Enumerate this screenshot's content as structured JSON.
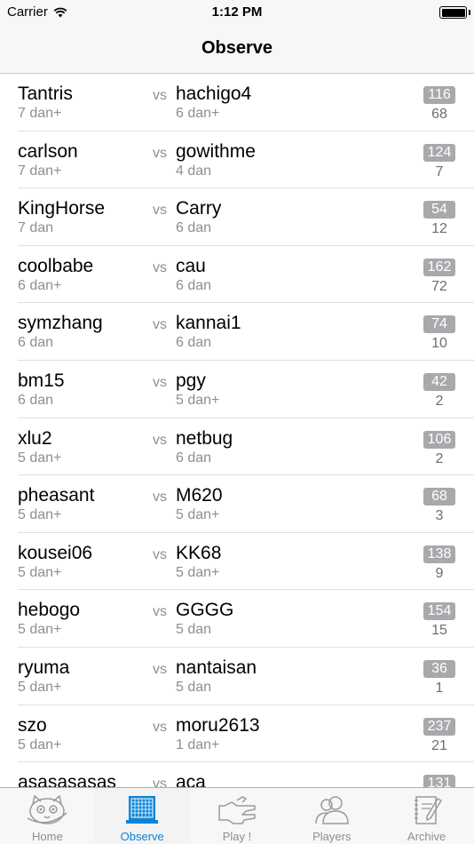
{
  "status_bar": {
    "carrier": "Carrier",
    "time": "1:12 PM"
  },
  "nav": {
    "title": "Observe"
  },
  "vs_label": "vs",
  "games": [
    {
      "p1": "Tantris",
      "p1_rank": "7 dan+",
      "p2": "hachigo4",
      "p2_rank": "6 dan+",
      "moves": "116",
      "observers": "68"
    },
    {
      "p1": "carlson",
      "p1_rank": "7 dan+",
      "p2": "gowithme",
      "p2_rank": "4 dan",
      "moves": "124",
      "observers": "7"
    },
    {
      "p1": "KingHorse",
      "p1_rank": "7 dan",
      "p2": "Carry",
      "p2_rank": "6 dan",
      "moves": "54",
      "observers": "12"
    },
    {
      "p1": "coolbabe",
      "p1_rank": "6 dan+",
      "p2": "cau",
      "p2_rank": "6 dan",
      "moves": "162",
      "observers": "72"
    },
    {
      "p1": "symzhang",
      "p1_rank": "6 dan",
      "p2": "kannai1",
      "p2_rank": "6 dan",
      "moves": "74",
      "observers": "10"
    },
    {
      "p1": "bm15",
      "p1_rank": "6 dan",
      "p2": "pgy",
      "p2_rank": "5 dan+",
      "moves": "42",
      "observers": "2"
    },
    {
      "p1": "xlu2",
      "p1_rank": "5 dan+",
      "p2": "netbug",
      "p2_rank": "6 dan",
      "moves": "106",
      "observers": "2"
    },
    {
      "p1": "pheasant",
      "p1_rank": "5 dan+",
      "p2": "M620",
      "p2_rank": "5 dan+",
      "moves": "68",
      "observers": "3"
    },
    {
      "p1": "kousei06",
      "p1_rank": "5 dan+",
      "p2": "KK68",
      "p2_rank": "5 dan+",
      "moves": "138",
      "observers": "9"
    },
    {
      "p1": "hebogo",
      "p1_rank": "5 dan+",
      "p2": "GGGG",
      "p2_rank": "5 dan",
      "moves": "154",
      "observers": "15"
    },
    {
      "p1": "ryuma",
      "p1_rank": "5 dan+",
      "p2": "nantaisan",
      "p2_rank": "5 dan",
      "moves": "36",
      "observers": "1"
    },
    {
      "p1": "szo",
      "p1_rank": "5 dan+",
      "p2": "moru2613",
      "p2_rank": "1 dan+",
      "moves": "237",
      "observers": "21"
    },
    {
      "p1": "asasasasas",
      "p1_rank": "",
      "p2": "aca",
      "p2_rank": "",
      "moves": "131",
      "observers": ""
    }
  ],
  "tabs": [
    {
      "label": "Home",
      "icon": "home-cat-icon",
      "active": false
    },
    {
      "label": "Observe",
      "icon": "board-icon",
      "active": true
    },
    {
      "label": "Play !",
      "icon": "hand-icon",
      "active": false
    },
    {
      "label": "Players",
      "icon": "players-icon",
      "active": false
    },
    {
      "label": "Archive",
      "icon": "archive-icon",
      "active": false
    }
  ],
  "colors": {
    "accent": "#0a84d8",
    "badge": "#a9a9ad",
    "secondary_text": "#8e8e93"
  }
}
